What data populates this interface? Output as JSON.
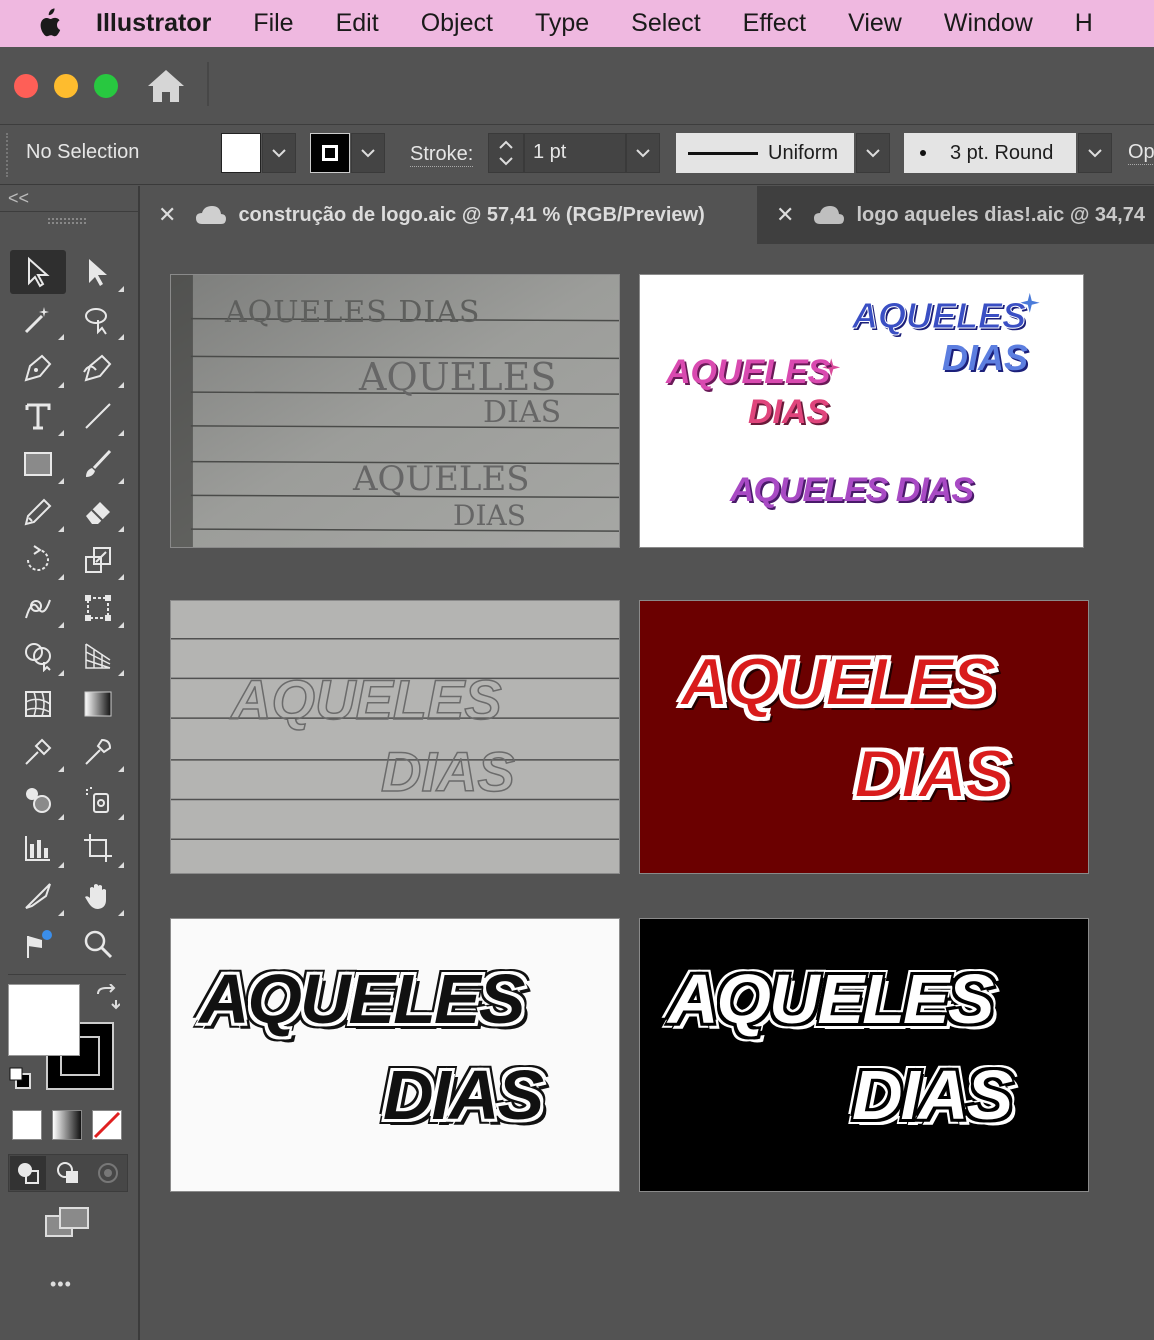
{
  "menubar": {
    "app_name": "Illustrator",
    "items": [
      "File",
      "Edit",
      "Object",
      "Type",
      "Select",
      "Effect",
      "View",
      "Window",
      "H"
    ]
  },
  "controlbar": {
    "selection": "No Selection",
    "stroke_label": "Stroke:",
    "stroke_weight": "1 pt",
    "profile": "Uniform",
    "brush": "3 pt. Round",
    "opacity_label": "Op"
  },
  "toolbar": {
    "collapse": "<<",
    "more": "•••"
  },
  "tabs": [
    {
      "title": "construção de logo.aic @ 57,41 % (RGB/Preview)",
      "active": true
    },
    {
      "title": "logo aqueles dias!.aic @ 34,74",
      "active": false
    }
  ],
  "artboards": {
    "logo_word_1": "AQUELES",
    "logo_word_2": "DIAS",
    "logo_inline": "AQUELES DIAS"
  },
  "colors": {
    "menubar_bg": "#efb8e0",
    "red_artboard": "#6b0000",
    "traffic_close": "#fe5f57",
    "traffic_min": "#febc2e",
    "traffic_max": "#28c840"
  }
}
